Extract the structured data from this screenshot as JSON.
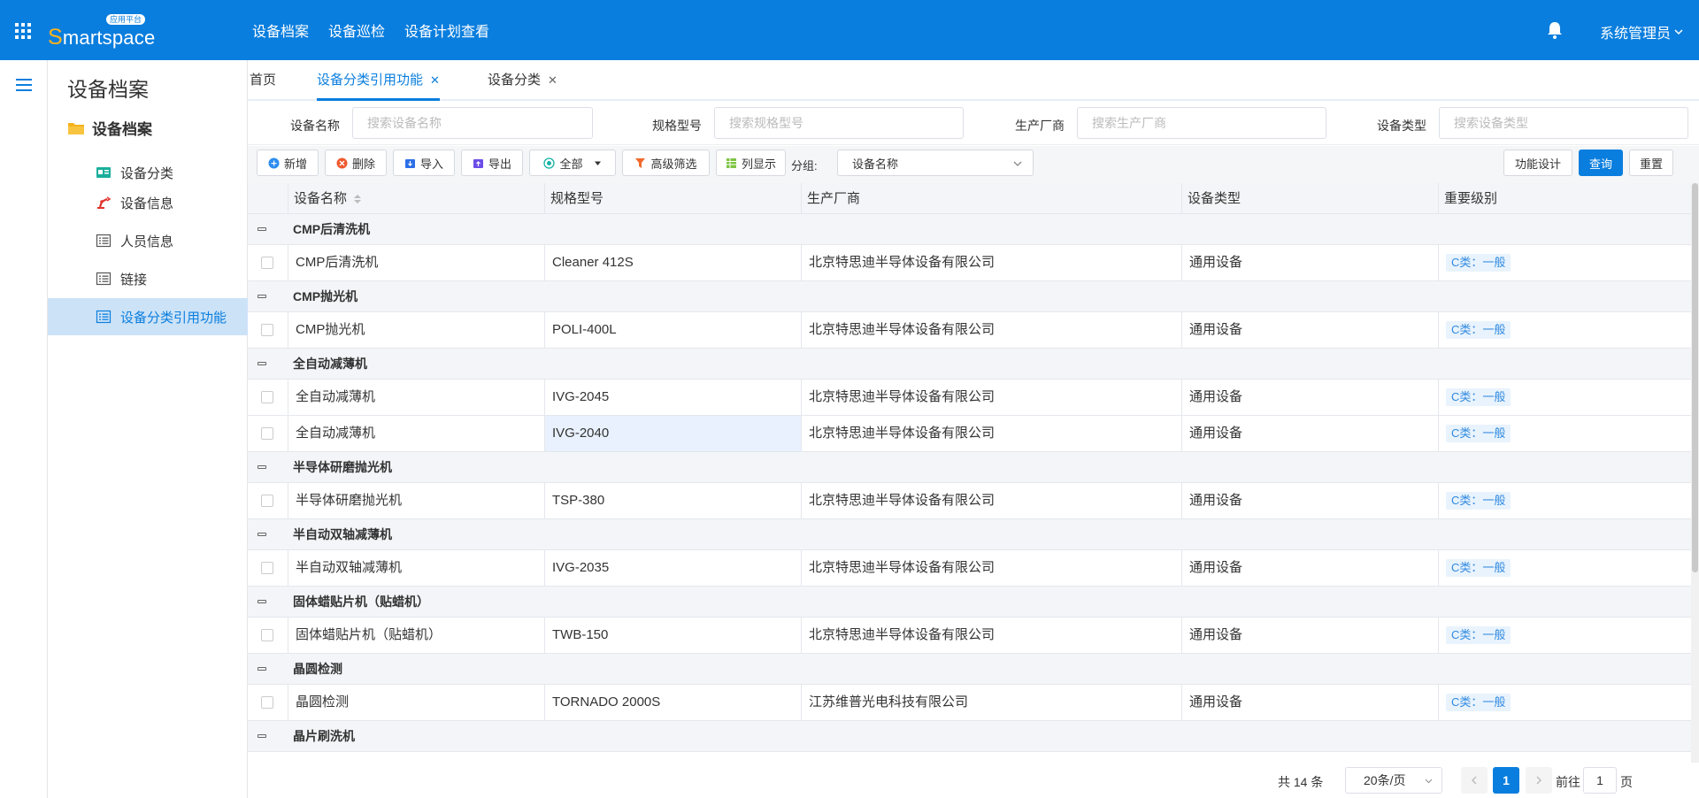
{
  "header": {
    "logo_text_first": "S",
    "logo_text_rest": "martspace",
    "logo_badge": "应用平台",
    "nav": [
      "设备档案",
      "设备巡检",
      "设备计划查看"
    ],
    "user": "系统管理员"
  },
  "sidebar": {
    "title": "设备档案",
    "group": "设备档案",
    "items": [
      {
        "label": "设备分类",
        "icon": "id-card-icon"
      },
      {
        "label": "设备信息",
        "icon": "robot-arm-icon"
      },
      {
        "label": "人员信息",
        "icon": "list-icon"
      },
      {
        "label": "链接",
        "icon": "list-icon"
      },
      {
        "label": "设备分类引用功能",
        "icon": "list-icon",
        "active": true
      }
    ]
  },
  "tabs": [
    {
      "label": "首页",
      "closable": false
    },
    {
      "label": "设备分类引用功能",
      "closable": true,
      "active": true
    },
    {
      "label": "设备分类",
      "closable": true
    }
  ],
  "search": {
    "fields": [
      {
        "label": "设备名称",
        "placeholder": "搜索设备名称"
      },
      {
        "label": "规格型号",
        "placeholder": "搜索规格型号"
      },
      {
        "label": "生产厂商",
        "placeholder": "搜索生产厂商"
      },
      {
        "label": "设备类型",
        "placeholder": "搜索设备类型"
      }
    ]
  },
  "toolbar": {
    "add": "新增",
    "delete": "删除",
    "import": "导入",
    "export": "导出",
    "all": "全部",
    "advanced_filter": "高级筛选",
    "columns": "列显示",
    "group_label": "分组:",
    "group_value": "设备名称",
    "design": "功能设计",
    "query": "查询",
    "reset": "重置"
  },
  "table": {
    "columns": [
      "设备名称",
      "规格型号",
      "生产厂商",
      "设备类型",
      "重要级别"
    ],
    "groups": [
      {
        "name": "CMP后清洗机",
        "rows": [
          [
            "CMP后清洗机",
            "Cleaner 412S",
            "北京特思迪半导体设备有限公司",
            "通用设备",
            "C类：一般"
          ]
        ]
      },
      {
        "name": "CMP抛光机",
        "rows": [
          [
            "CMP抛光机",
            "POLI-400L",
            "北京特思迪半导体设备有限公司",
            "通用设备",
            "C类：一般"
          ]
        ]
      },
      {
        "name": "全自动减薄机",
        "rows": [
          [
            "全自动减薄机",
            "IVG-2045",
            "北京特思迪半导体设备有限公司",
            "通用设备",
            "C类：一般"
          ],
          [
            "全自动减薄机",
            "IVG-2040",
            "北京特思迪半导体设备有限公司",
            "通用设备",
            "C类：一般"
          ]
        ]
      },
      {
        "name": "半导体研磨抛光机",
        "rows": [
          [
            "半导体研磨抛光机",
            "TSP-380",
            "北京特思迪半导体设备有限公司",
            "通用设备",
            "C类：一般"
          ]
        ]
      },
      {
        "name": "半自动双轴减薄机",
        "rows": [
          [
            "半自动双轴减薄机",
            "IVG-2035",
            "北京特思迪半导体设备有限公司",
            "通用设备",
            "C类：一般"
          ]
        ]
      },
      {
        "name": "固体蜡贴片机（贴蜡机）",
        "rows": [
          [
            "固体蜡贴片机（贴蜡机）",
            "TWB-150",
            "北京特思迪半导体设备有限公司",
            "通用设备",
            "C类：一般"
          ]
        ]
      },
      {
        "name": "晶圆检测",
        "rows": [
          [
            "晶圆检测",
            "TORNADO 2000S",
            "江苏维普光电科技有限公司",
            "通用设备",
            "C类：一般"
          ]
        ]
      },
      {
        "name": "晶片刷洗机",
        "rows": []
      }
    ]
  },
  "pagination": {
    "total": "共 14 条",
    "page_size": "20条/页",
    "current": "1",
    "goto_label": "前往",
    "goto_value": "1",
    "page_unit": "页"
  },
  "colors": {
    "primary": "#0a7ede",
    "tag_bg": "#e9f3fd",
    "tag_text": "#2f8ae0"
  }
}
